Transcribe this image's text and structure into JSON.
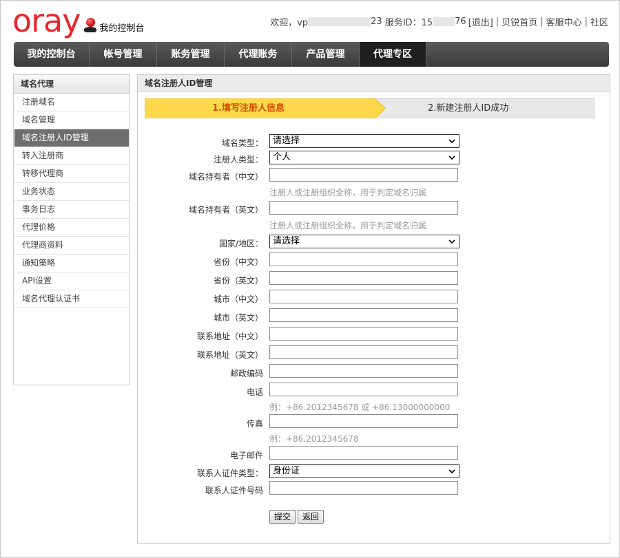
{
  "brand": {
    "logo": "oray",
    "subtitle": "我的控制台",
    "accent": "#e8262e"
  },
  "topbar": {
    "welcome": "欢迎，vp",
    "user_suffix": "23",
    "service_label": "服务ID：15",
    "service_suffix": "76",
    "logout": "[退出]",
    "links": [
      "贝锐首页",
      "客服中心",
      "社区"
    ],
    "divider": "|",
    "dash": "-"
  },
  "nav": {
    "items": [
      {
        "label": "我的控制台",
        "width": 109
      },
      {
        "label": "帐号管理",
        "width": 97
      },
      {
        "label": "账务管理",
        "width": 97
      },
      {
        "label": "代理账务",
        "width": 97
      },
      {
        "label": "产品管理",
        "width": 97
      },
      {
        "label": "代理专区",
        "width": 96,
        "active": true
      }
    ]
  },
  "sidebar": {
    "title": "域名代理",
    "items": [
      {
        "label": "注册域名"
      },
      {
        "label": "域名管理"
      },
      {
        "label": "域名注册人ID管理",
        "active": true
      },
      {
        "label": "转入注册商"
      },
      {
        "label": "转移代理商"
      },
      {
        "label": "业务状态"
      },
      {
        "label": "事务日志"
      },
      {
        "label": "代理价格"
      },
      {
        "label": "代理商资料"
      },
      {
        "label": "通知策略"
      },
      {
        "label": "API设置"
      },
      {
        "label": "域名代理认证书"
      }
    ]
  },
  "main": {
    "title": "域名注册人ID管理",
    "steps": [
      {
        "label": "1.填写注册人信息",
        "active": true,
        "color": "#fdd84a"
      },
      {
        "label": "2.新建注册人ID成功",
        "active": false
      }
    ]
  },
  "form": {
    "domain_type": {
      "label": "域名类型：",
      "value": "请选择"
    },
    "registrant_type": {
      "label": "注册人类型：",
      "value": "个人"
    },
    "owner_cn": {
      "label": "域名持有者（中文）",
      "value": "",
      "hint": "注册人或注册组织全称，用于判定域名归属"
    },
    "owner_en": {
      "label": "域名持有者（英文）",
      "value": "",
      "hint": "注册人或注册组织全称，用于判定域名归属"
    },
    "country": {
      "label": "国家/地区：",
      "value": "请选择"
    },
    "province_cn": {
      "label": "省份（中文）",
      "value": ""
    },
    "province_en": {
      "label": "省份（英文）",
      "value": ""
    },
    "city_cn": {
      "label": "城市（中文）",
      "value": ""
    },
    "city_en": {
      "label": "城市（英文）",
      "value": ""
    },
    "address_cn": {
      "label": "联系地址（中文）",
      "value": ""
    },
    "address_en": {
      "label": "联系地址（英文）",
      "value": ""
    },
    "postcode": {
      "label": "邮政编码",
      "value": ""
    },
    "phone": {
      "label": "电话",
      "value": "",
      "hint": "例：+86.2012345678 或 +86.13000000000"
    },
    "fax": {
      "label": "传真",
      "value": "",
      "hint": "例：+86.2012345678"
    },
    "email": {
      "label": "电子邮件",
      "value": ""
    },
    "id_type": {
      "label": "联系人证件类型：",
      "value": "身份证"
    },
    "id_number": {
      "label": "联系人证件号码",
      "value": ""
    },
    "colon": "：",
    "submit": "提交",
    "back": "返回"
  }
}
